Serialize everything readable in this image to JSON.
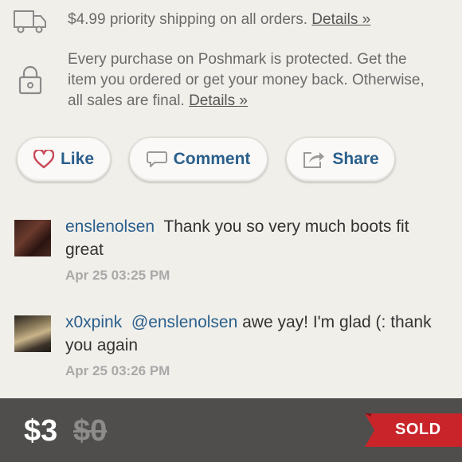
{
  "shipping": {
    "text": "$4.99 priority shipping on all orders.",
    "link": "Details »"
  },
  "protection": {
    "text": "Every purchase on Poshmark is protected. Get the item you ordered or get your money back. Otherwise, all sales are final.",
    "link": "Details »"
  },
  "actions": {
    "like_label": "Like",
    "comment_label": "Comment",
    "share_label": "Share"
  },
  "comments": [
    {
      "username": "enslenolsen",
      "mention": "",
      "text": "Thank you so very much boots fit great",
      "time": "Apr 25 03:25 PM"
    },
    {
      "username": "x0xpink",
      "mention": "@enslenolsen",
      "text": "awe yay! I'm glad (: thank you again",
      "time": "Apr 25 03:26 PM"
    }
  ],
  "listing": {
    "price": "$3",
    "original_price": "$0",
    "status": "SOLD"
  },
  "colors": {
    "accent": "#2a5f8c",
    "like_heart": "#c94a5a",
    "sold_ribbon": "#c8242a",
    "bottom_bar": "#4f4e4c"
  }
}
